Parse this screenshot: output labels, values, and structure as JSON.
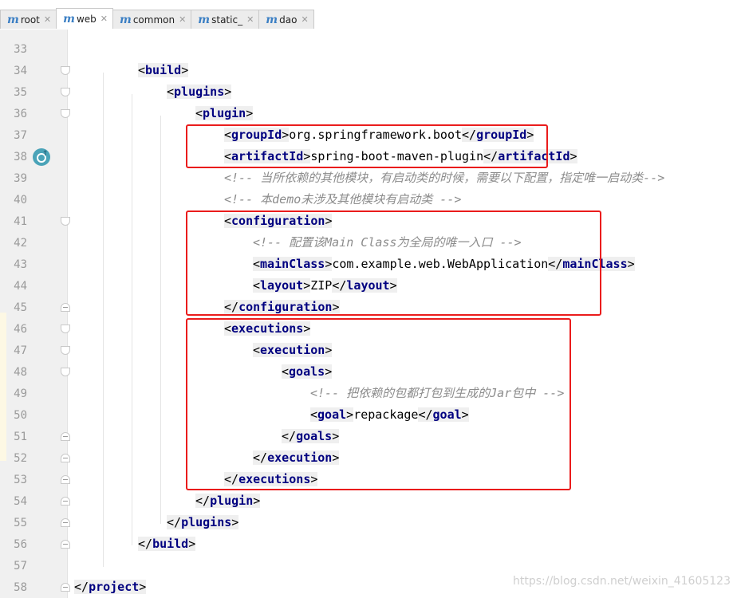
{
  "tabs": [
    {
      "label": "root",
      "active": false
    },
    {
      "label": "web",
      "active": true
    },
    {
      "label": "common",
      "active": false
    },
    {
      "label": "static_",
      "active": false
    },
    {
      "label": "dao",
      "active": false
    }
  ],
  "code_lines": [
    {
      "n": "33",
      "tokens": []
    },
    {
      "n": "34",
      "tokens": [
        {
          "t": "<",
          "k": "br"
        },
        {
          "t": "build",
          "k": "tn"
        },
        {
          "t": ">",
          "k": "br"
        }
      ]
    },
    {
      "n": "35",
      "tokens": [
        {
          "t": "<",
          "k": "br"
        },
        {
          "t": "plugins",
          "k": "tn"
        },
        {
          "t": ">",
          "k": "br"
        }
      ]
    },
    {
      "n": "36",
      "tokens": [
        {
          "t": "<",
          "k": "br"
        },
        {
          "t": "plugin",
          "k": "tn"
        },
        {
          "t": ">",
          "k": "br"
        }
      ]
    },
    {
      "n": "37",
      "tokens": [
        {
          "t": "<",
          "k": "br"
        },
        {
          "t": "groupId",
          "k": "tn"
        },
        {
          "t": ">",
          "k": "br"
        },
        {
          "t": "org.springframework.boot",
          "k": "txt"
        },
        {
          "t": "</",
          "k": "br"
        },
        {
          "t": "groupId",
          "k": "tn"
        },
        {
          "t": ">",
          "k": "br"
        }
      ]
    },
    {
      "n": "38",
      "tokens": [
        {
          "t": "<",
          "k": "br"
        },
        {
          "t": "artifactId",
          "k": "tn"
        },
        {
          "t": ">",
          "k": "br"
        },
        {
          "t": "spring-boot-maven-plugin",
          "k": "txt"
        },
        {
          "t": "</",
          "k": "br"
        },
        {
          "t": "artifactId",
          "k": "tn"
        },
        {
          "t": ">",
          "k": "br"
        }
      ]
    },
    {
      "n": "39",
      "tokens": [
        {
          "t": "<!-- 当所依赖的其他模块，有启动类的时候，需要以下配置，指定唯一启动类-->",
          "k": "cmt"
        }
      ]
    },
    {
      "n": "40",
      "tokens": [
        {
          "t": "<!-- 本demo未涉及其他模块有启动类 -->",
          "k": "cmt"
        }
      ]
    },
    {
      "n": "41",
      "tokens": [
        {
          "t": "<",
          "k": "br"
        },
        {
          "t": "configuration",
          "k": "tn"
        },
        {
          "t": ">",
          "k": "br"
        }
      ]
    },
    {
      "n": "42",
      "tokens": [
        {
          "t": "<!-- 配置该Main Class为全局的唯一入口 -->",
          "k": "cmt"
        }
      ]
    },
    {
      "n": "43",
      "tokens": [
        {
          "t": "<",
          "k": "br"
        },
        {
          "t": "mainClass",
          "k": "tn"
        },
        {
          "t": ">",
          "k": "br"
        },
        {
          "t": "com.example.web.WebApplication",
          "k": "txt"
        },
        {
          "t": "</",
          "k": "br"
        },
        {
          "t": "mainClass",
          "k": "tn"
        },
        {
          "t": ">",
          "k": "br"
        }
      ]
    },
    {
      "n": "44",
      "tokens": [
        {
          "t": "<",
          "k": "br"
        },
        {
          "t": "layout",
          "k": "tn"
        },
        {
          "t": ">",
          "k": "br"
        },
        {
          "t": "ZIP",
          "k": "txt"
        },
        {
          "t": "</",
          "k": "br"
        },
        {
          "t": "layout",
          "k": "tn"
        },
        {
          "t": ">",
          "k": "br"
        }
      ]
    },
    {
      "n": "45",
      "tokens": [
        {
          "t": "</",
          "k": "br"
        },
        {
          "t": "configuration",
          "k": "tn"
        },
        {
          "t": ">",
          "k": "br"
        }
      ]
    },
    {
      "n": "46",
      "tokens": [
        {
          "t": "<",
          "k": "br"
        },
        {
          "t": "executions",
          "k": "tn"
        },
        {
          "t": ">",
          "k": "br"
        }
      ]
    },
    {
      "n": "47",
      "tokens": [
        {
          "t": "<",
          "k": "br"
        },
        {
          "t": "execution",
          "k": "tn"
        },
        {
          "t": ">",
          "k": "br"
        }
      ]
    },
    {
      "n": "48",
      "tokens": [
        {
          "t": "<",
          "k": "br"
        },
        {
          "t": "goals",
          "k": "tn"
        },
        {
          "t": ">",
          "k": "br"
        }
      ]
    },
    {
      "n": "49",
      "tokens": [
        {
          "t": "<!-- 把依赖的包都打包到生成的Jar包中 -->",
          "k": "cmt"
        }
      ]
    },
    {
      "n": "50",
      "tokens": [
        {
          "t": "<",
          "k": "br"
        },
        {
          "t": "goal",
          "k": "tn"
        },
        {
          "t": ">",
          "k": "br"
        },
        {
          "t": "repackage",
          "k": "txt"
        },
        {
          "t": "</",
          "k": "br"
        },
        {
          "t": "goal",
          "k": "tn"
        },
        {
          "t": ">",
          "k": "br"
        }
      ]
    },
    {
      "n": "51",
      "tokens": [
        {
          "t": "</",
          "k": "br"
        },
        {
          "t": "goals",
          "k": "tn"
        },
        {
          "t": ">",
          "k": "br"
        }
      ]
    },
    {
      "n": "52",
      "tokens": [
        {
          "t": "</",
          "k": "br"
        },
        {
          "t": "execution",
          "k": "tn"
        },
        {
          "t": ">",
          "k": "br"
        }
      ]
    },
    {
      "n": "53",
      "tokens": [
        {
          "t": "</",
          "k": "br"
        },
        {
          "t": "executions",
          "k": "tn"
        },
        {
          "t": ">",
          "k": "br"
        }
      ]
    },
    {
      "n": "54",
      "tokens": [
        {
          "t": "</",
          "k": "br"
        },
        {
          "t": "plugin",
          "k": "tn"
        },
        {
          "t": ">",
          "k": "br"
        }
      ]
    },
    {
      "n": "55",
      "tokens": [
        {
          "t": "</",
          "k": "br"
        },
        {
          "t": "plugins",
          "k": "tn"
        },
        {
          "t": ">",
          "k": "br"
        }
      ]
    },
    {
      "n": "56",
      "tokens": [
        {
          "t": "</",
          "k": "br"
        },
        {
          "t": "build",
          "k": "tn"
        },
        {
          "t": ">",
          "k": "br"
        }
      ]
    },
    {
      "n": "57",
      "tokens": []
    },
    {
      "n": "58",
      "tokens": [
        {
          "t": "</",
          "k": "br"
        },
        {
          "t": "project",
          "k": "tn"
        },
        {
          "t": ">",
          "k": "br"
        }
      ]
    }
  ],
  "watermark": "https://blog.csdn.net/weixin_41605123",
  "colors": {
    "highlight_box": "#ea1c1c",
    "tag_name": "#000080",
    "comment": "#8c8c8c",
    "line_number": "#9a9a9a"
  },
  "icons": {
    "gutter_line_38": "spring-boot-run-icon",
    "tab_marker": "maven-module-icon"
  }
}
